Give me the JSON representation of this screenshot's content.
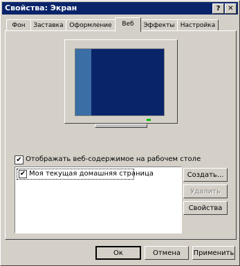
{
  "window": {
    "title": "Свойства: Экран"
  },
  "titlebar": {
    "help_glyph": "?",
    "close_glyph": "✕"
  },
  "tabs": [
    {
      "label": "Фон"
    },
    {
      "label": "Заставка"
    },
    {
      "label": "Оформление"
    },
    {
      "label": "Веб"
    },
    {
      "label": "Эффекты"
    },
    {
      "label": "Настройка"
    }
  ],
  "web": {
    "show_web_content_label": "Отображать веб-содержимое на рабочем столе",
    "show_web_content_checked": true,
    "items": [
      {
        "label": "Моя текущая домашняя страница",
        "checked": true
      }
    ],
    "buttons": {
      "create": "Создать...",
      "delete": "Удалить",
      "properties": "Свойства"
    }
  },
  "footer": {
    "ok": "Ок",
    "cancel": "Отмена",
    "apply": "Применить"
  },
  "colors": {
    "titlebar": "#0a246a",
    "desktop": "#0a246a",
    "sidebar": "#3a6ea5",
    "face": "#d4d0c8"
  },
  "checkmark": "✔"
}
